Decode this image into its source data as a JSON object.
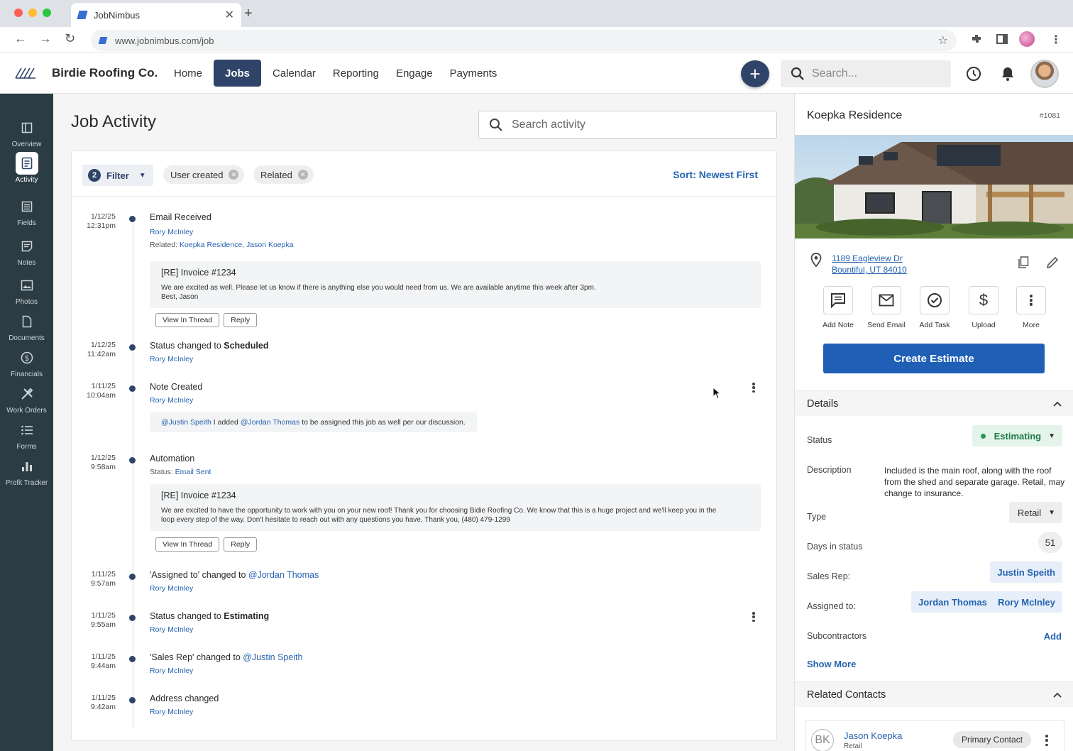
{
  "browser": {
    "tab_title": "JobNimbus",
    "url": "www.jobnimbus.com/job"
  },
  "header": {
    "brand": "Birdie Roofing Co.",
    "nav": [
      {
        "label": "Home",
        "active": false
      },
      {
        "label": "Jobs",
        "active": true
      },
      {
        "label": "Calendar",
        "active": false
      },
      {
        "label": "Reporting",
        "active": false
      },
      {
        "label": "Engage",
        "active": false
      },
      {
        "label": "Payments",
        "active": false
      }
    ],
    "search_placeholder": "Search..."
  },
  "sidebar": {
    "items": [
      {
        "label": "Overview",
        "icon": "overview-icon",
        "active": false
      },
      {
        "label": "Activity",
        "icon": "activity-icon",
        "active": true
      },
      {
        "label": "Fields",
        "icon": "fields-icon",
        "active": false
      },
      {
        "label": "Notes",
        "icon": "notes-icon",
        "active": false
      },
      {
        "label": "Photos",
        "icon": "photos-icon",
        "active": false
      },
      {
        "label": "Documents",
        "icon": "documents-icon",
        "active": false
      },
      {
        "label": "Financials",
        "icon": "financials-icon",
        "active": false
      },
      {
        "label": "Work Orders",
        "icon": "work-orders-icon",
        "active": false
      },
      {
        "label": "Forms",
        "icon": "forms-icon",
        "active": false
      },
      {
        "label": "Profit Tracker",
        "icon": "profit-tracker-icon",
        "active": false
      }
    ]
  },
  "activity": {
    "page_title": "Job Activity",
    "search_placeholder": "Search activity",
    "filter": {
      "count": "2",
      "label": "Filter"
    },
    "chips": [
      "User created",
      "Related"
    ],
    "sort_label": "Sort: Newest First",
    "entries": [
      {
        "date": "1/12/25",
        "time": "12:31pm",
        "title": "Email Received",
        "user": "Rory McInley",
        "related_prefix": "Related:",
        "related_1": "Koepka Residence",
        "related_sep": ",",
        "related_2": "Jason Koepka",
        "subject": "[RE] Invoice #1234",
        "body_line1": "We are excited as well.  Please let us know if there is anything else you would need from us.  We are available anytime this week after 3pm.",
        "body_line2": "Best, Jason",
        "btn_thread": "View In Thread",
        "btn_reply": "Reply"
      },
      {
        "date": "1/12/25",
        "time": "11:42am",
        "title_prefix": "Status changed to ",
        "title_bold": "Scheduled",
        "user": "Rory McInley"
      },
      {
        "date": "1/11/25",
        "time": "10:04am",
        "title": "Note Created",
        "user": "Rory McInley",
        "note_mention1": "@Justin Speith",
        "note_text1": "I added",
        "note_mention2": "@Jordan Thomas",
        "note_text2": "to be assigned this job as well per our discussion."
      },
      {
        "date": "1/12/25",
        "time": "9:58am",
        "title": "Automation",
        "status_prefix": "Status:",
        "status_value": "Email Sent",
        "subject": "[RE] Invoice #1234",
        "body_line1": "We are excited to have the opportunity to work with you on your new roof! Thank you for choosing Bidie Roofing Co.   We know that this is a huge project and we'll keep you in the",
        "body_line2": "loop every step of the way.   Don't hesitate to reach out with any questions you have.   Thank you,     (480) 479-1299",
        "btn_thread": "View In Thread",
        "btn_reply": "Reply"
      },
      {
        "date": "1/11/25",
        "time": "9:57am",
        "title_prefix": "'Assigned to' changed to ",
        "title_mention": "@Jordan Thomas",
        "user": "Rory McInley"
      },
      {
        "date": "1/11/25",
        "time": "9:55am",
        "title_prefix": "Status changed to ",
        "title_bold": "Estimating",
        "user": "Rory McInley"
      },
      {
        "date": "1/11/25",
        "time": "9:44am",
        "title_prefix": "'Sales Rep' changed to ",
        "title_mention": "@Justin Speith",
        "user": "Rory McInley"
      },
      {
        "date": "1/11/25",
        "time": "9:42am",
        "title": "Address changed",
        "user": "Rory McInley"
      }
    ]
  },
  "job": {
    "name": "Koepka Residence",
    "number": "#1081",
    "address_line1": "1189 Eagleview Dr",
    "address_line2": "Bountiful, UT 84010",
    "quick_actions": [
      "Add Note",
      "Send Email",
      "Add Task",
      "Upload",
      "More"
    ],
    "create_estimate": "Create Estimate",
    "details_header": "Details",
    "status_label": "Status",
    "status_value": "Estimating",
    "description_label": "Description",
    "description": "Included is the main roof, along with the roof from the shed and separate garage.  Retail, may change to insurance.",
    "type_label": "Type",
    "type_value": "Retail",
    "days_label": "Days in status",
    "days_value": "51",
    "sales_rep_label": "Sales Rep:",
    "sales_rep": "Justin Speith",
    "assigned_label": "Assigned to:",
    "assigned": [
      "Jordan Thomas",
      "Rory McInley"
    ],
    "subcontractors_label": "Subcontractors",
    "subcontractors_add": "Add",
    "show_more": "Show More",
    "related_header": "Related Contacts",
    "contact": {
      "initials": "BK",
      "name": "Jason Koepka",
      "type": "Retail",
      "badge": "Primary Contact"
    }
  },
  "colors": {
    "nav_active": "#2f4468",
    "sidebar_bg": "#2c3c44",
    "link_blue": "#2563b0",
    "primary_button": "#1f5fb6",
    "status_green": "#1f9a58"
  }
}
